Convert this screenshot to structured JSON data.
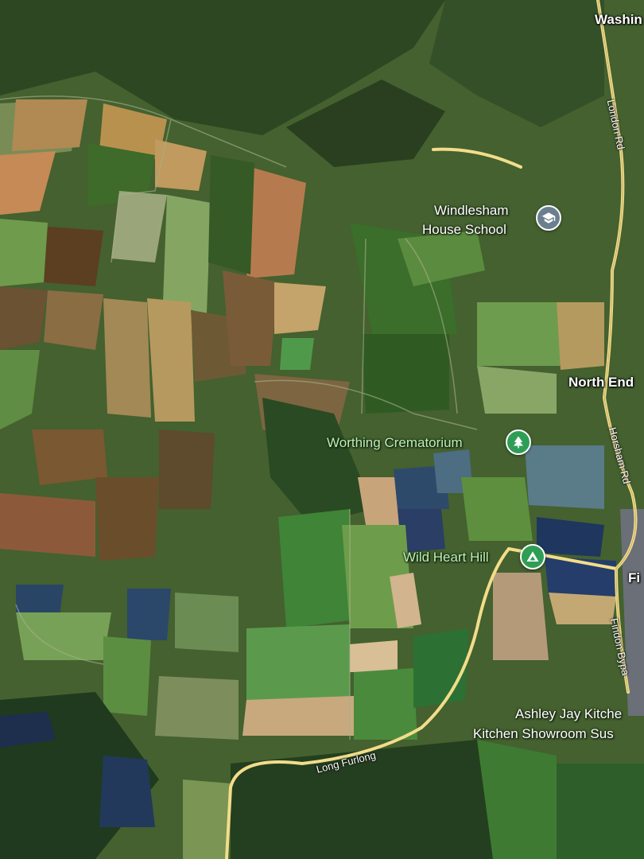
{
  "map": {
    "type": "satellite",
    "places": {
      "washington": "Washin",
      "north_end": "North End",
      "findon": "Fi"
    },
    "pois": {
      "school": {
        "name_line1": "Windlesham",
        "name_line2": "House School",
        "icon": "school-icon",
        "color": "#6b7f8f"
      },
      "crematorium": {
        "name": "Worthing Crematorium",
        "icon": "tree-icon",
        "color": "#2f9e55"
      },
      "wild_heart_hill": {
        "name": "Wild Heart Hill",
        "icon": "campsite-icon",
        "color": "#2f9e55"
      },
      "kitchen": {
        "name_line1": "Ashley Jay Kitche",
        "name_line2": "Kitchen Showroom Sus"
      }
    },
    "roads": {
      "london_rd": "London Rd",
      "horsham_rd": "Horsham Rd",
      "findon_bypass": "Findon Bypa",
      "long_furlong": "Long Furlong"
    }
  }
}
